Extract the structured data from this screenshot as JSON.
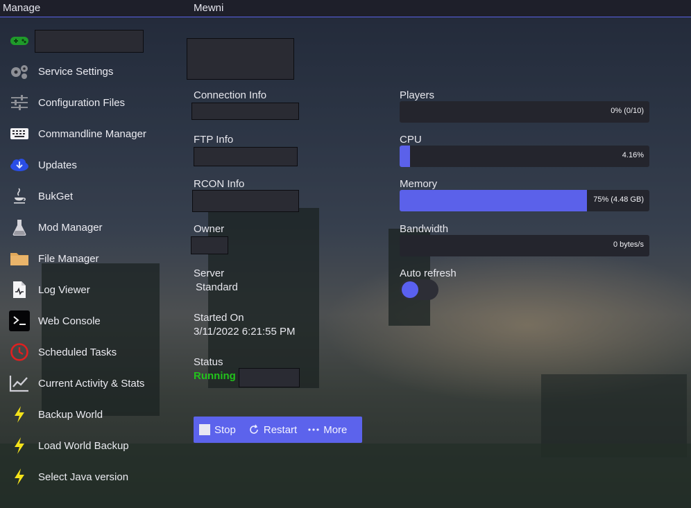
{
  "topbar": {
    "manage_label": "Manage",
    "server_title": "Mewni"
  },
  "sidebar": {
    "items": [
      {
        "label": "",
        "icon": "gamepad-icon"
      },
      {
        "label": "Service Settings",
        "icon": "gears-icon"
      },
      {
        "label": "Configuration Files",
        "icon": "sliders-icon"
      },
      {
        "label": "Commandline Manager",
        "icon": "keyboard-icon"
      },
      {
        "label": "Updates",
        "icon": "cloud-download-icon"
      },
      {
        "label": "BukGet",
        "icon": "java-icon"
      },
      {
        "label": "Mod Manager",
        "icon": "flask-icon"
      },
      {
        "label": "File Manager",
        "icon": "folder-icon"
      },
      {
        "label": "Log Viewer",
        "icon": "log-file-icon"
      },
      {
        "label": "Web Console",
        "icon": "terminal-icon"
      },
      {
        "label": "Scheduled Tasks",
        "icon": "clock-icon"
      },
      {
        "label": "Current Activity & Stats",
        "icon": "chart-line-icon"
      },
      {
        "label": "Backup World",
        "icon": "lightning-icon"
      },
      {
        "label": "Load World Backup",
        "icon": "lightning-icon"
      },
      {
        "label": "Select Java version",
        "icon": "lightning-icon"
      }
    ]
  },
  "info": {
    "connection_label": "Connection Info",
    "ftp_label": "FTP Info",
    "rcon_label": "RCON Info",
    "owner_label": "Owner",
    "server_label": "Server",
    "server_value": "Standard",
    "started_label": "Started On",
    "started_value": "3/11/2022 6:21:55 PM",
    "status_label": "Status",
    "status_value": "Running"
  },
  "stats": {
    "players": {
      "label": "Players",
      "value_text": "0% (0/10)",
      "fraction": 0.0
    },
    "cpu": {
      "label": "CPU",
      "value_text": "4.16%",
      "fraction": 0.0416
    },
    "memory": {
      "label": "Memory",
      "value_text": "75% (4.48 GB)",
      "fraction": 0.75
    },
    "bandwidth": {
      "label": "Bandwidth",
      "value_text": "0 bytes/s",
      "fraction": 0.0
    },
    "auto_refresh_label": "Auto refresh",
    "auto_refresh_on": true
  },
  "actions": {
    "stop_label": "Stop",
    "restart_label": "Restart",
    "more_label": "More"
  },
  "colors": {
    "accent": "#5b61ea",
    "running": "#22c31c",
    "topbar_bg": "#1e1f2a"
  }
}
